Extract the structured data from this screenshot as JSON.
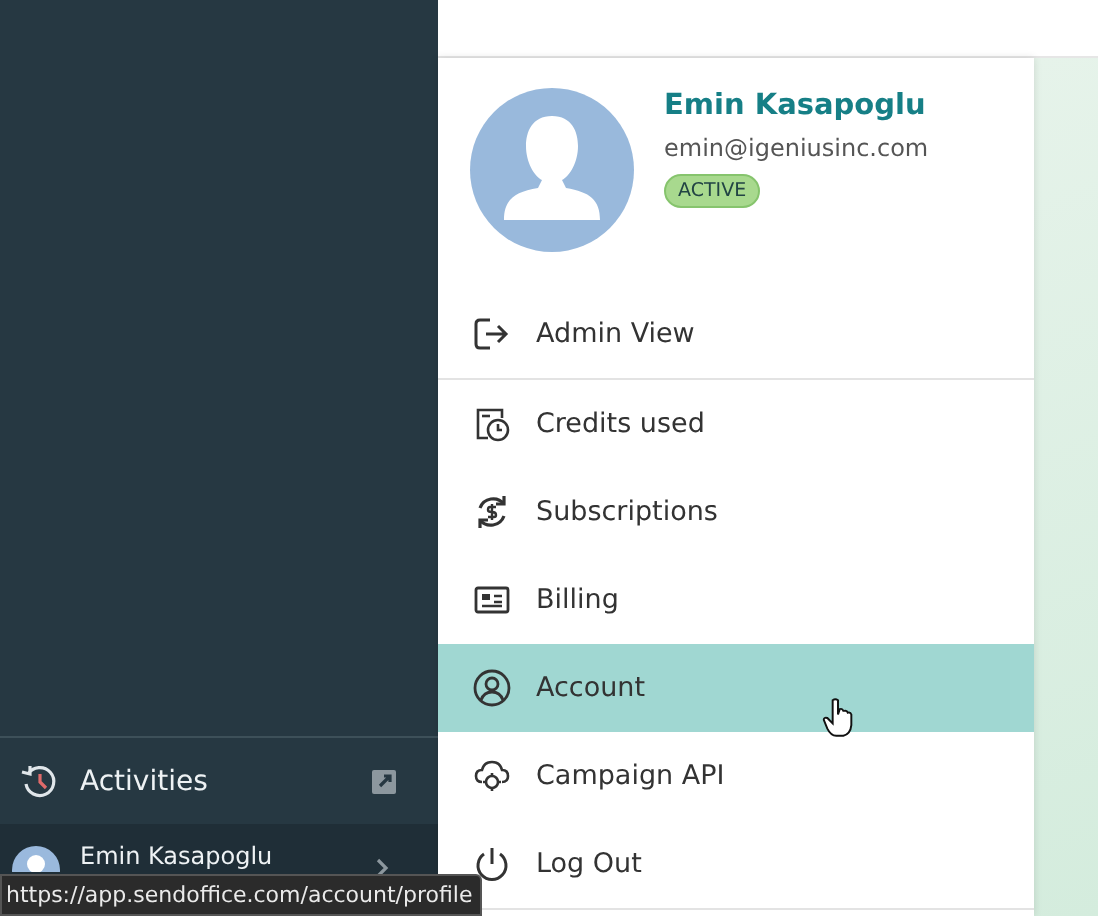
{
  "sidebar": {
    "activities": {
      "label": "Activities"
    },
    "user": {
      "name": "Emin Kasapoglu"
    }
  },
  "profile": {
    "name": "Emin Kasapoglu",
    "email": "emin@igeniusinc.com",
    "status": "ACTIVE"
  },
  "menu": {
    "sections": [
      [
        {
          "label": "Admin View",
          "selected": false
        }
      ],
      [
        {
          "label": "Credits used",
          "selected": false
        },
        {
          "label": "Subscriptions",
          "selected": false
        },
        {
          "label": "Billing",
          "selected": false
        },
        {
          "label": "Account",
          "selected": true
        },
        {
          "label": "Campaign API",
          "selected": false
        },
        {
          "label": "Log Out",
          "selected": false
        }
      ]
    ]
  },
  "status_bar": {
    "url": "https://app.sendoffice.com/account/profile"
  }
}
